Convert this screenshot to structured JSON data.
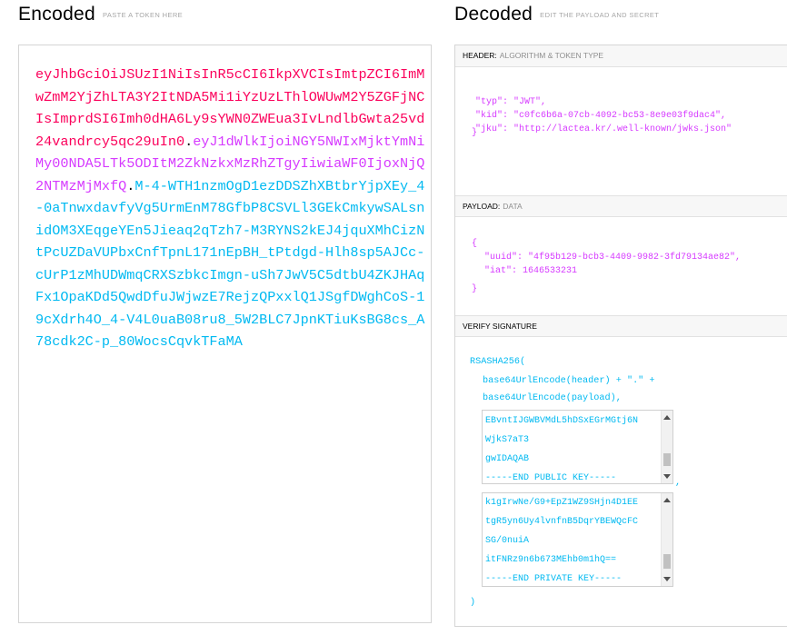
{
  "encoded": {
    "title": "Encoded",
    "subtitle": "PASTE A TOKEN HERE",
    "token_header": "eyJhbGciOiJSUzI1NiIsInR5cCI6IkpXVCIsImtpZCI6ImMwZmM2YjZhLTA3Y2ItNDA5Mi1iYzUzLThlOWUwM2Y5ZGFjNCIsImprdSI6Imh0dHA6Ly9sYWN0ZWEua3IvLndlbGwta25vd24vandrcy5qc29uIn0",
    "token_payload": "eyJ1dWlkIjoiNGY5NWIxMjktYmNiMy00NDA5LTk5ODItM2ZkNzkxMzRhZTgyIiwiaWF0IjoxNjQ2NTMzMjMxfQ",
    "token_signature": "M-4-WTH1nzmOgD1ezDDSZhXBtbrYjpXEy_4-0aTnwxdavfyVg5UrmEnM78GfbP8CSVLl3GEkCmkywSALsnidOM3XEqgeYEn5Jieaq2qTzh7-M3RYNS2kEJ4jquXMhCizNtPcUZDaVUPbxCnfTpnL171nEpBH_tPtdgd-Hlh8sp5AJCc-cUrP1zMhUDWmqCRXSzbkcImgn-uSh7JwV5C5dtbU4ZKJHAqFx1OpaKDd5QwdDfuJWjwzE7RejzQPxxlQ1JSgfDWghCoS-19cXdrh4O_4-V4L0uaB08ru8_5W2BLC7JpnKTiuKsBG8cs_A78cdk2C-p_80WocsCqvkTFaMA",
    "dot": "."
  },
  "decoded": {
    "title": "Decoded",
    "subtitle": "EDIT THE PAYLOAD AND SECRET",
    "header": {
      "label": "HEADER:",
      "sublabel": "ALGORITHM & TOKEN TYPE",
      "lines": [
        "\"typ\": \"JWT\",",
        "\"kid\": \"c0fc6b6a-07cb-4092-bc53-8e9e03f9dac4\",",
        "\"jku\": \"http://lactea.kr/.well-known/jwks.json\""
      ],
      "close": "}"
    },
    "payload": {
      "label": "PAYLOAD:",
      "sublabel": "DATA",
      "open": "{",
      "lines": [
        "\"uuid\": \"4f95b129-bcb3-4409-9982-3fd79134ae82\",",
        "\"iat\": 1646533231"
      ],
      "close": "}"
    },
    "verify": {
      "label": "VERIFY SIGNATURE",
      "alg": "RSASHA256(",
      "line1": "base64UrlEncode(header) + \".\" +",
      "line2": "base64UrlEncode(payload),",
      "public_key_lines": [
        "EBvntIJGWBVMdL5hDSxEGrMGtj6N",
        "WjkS7aT3",
        "gwIDAQAB",
        "-----END PUBLIC KEY-----"
      ],
      "comma": ",",
      "private_key_lines": [
        "k1gIrwNe/G9+EpZ1WZ9SHjn4D1EE",
        "tgR5yn6Uy4lvnfnB5DqrYBEWQcFC",
        "SG/0nuiA",
        "itFNRz9n6b673MEhb0m1hQ==",
        "-----END PRIVATE KEY-----"
      ],
      "close": ")"
    }
  }
}
